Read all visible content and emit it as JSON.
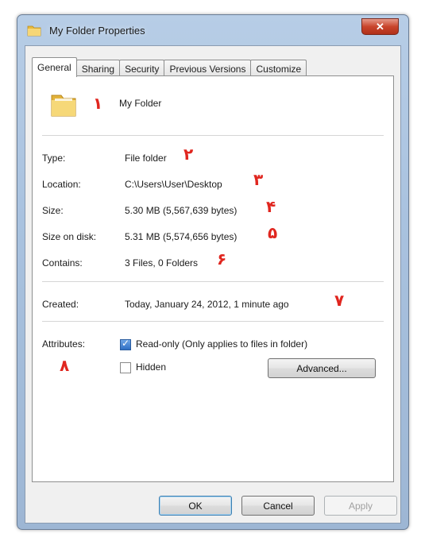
{
  "window": {
    "title": "My Folder Properties",
    "close_label": "✕"
  },
  "tabs": [
    {
      "label": "General",
      "active": true
    },
    {
      "label": "Sharing"
    },
    {
      "label": "Security"
    },
    {
      "label": "Previous Versions"
    },
    {
      "label": "Customize"
    }
  ],
  "general": {
    "folder_name": "My Folder",
    "type_label": "Type:",
    "type_value": "File folder",
    "location_label": "Location:",
    "location_value": "C:\\Users\\User\\Desktop",
    "size_label": "Size:",
    "size_value": "5.30 MB (5,567,639 bytes)",
    "size_on_disk_label": "Size on disk:",
    "size_on_disk_value": "5.31 MB (5,574,656 bytes)",
    "contains_label": "Contains:",
    "contains_value": "3 Files, 0 Folders",
    "created_label": "Created:",
    "created_value": "Today, January 24, 2012, 1 minute ago",
    "attributes_label": "Attributes:",
    "readonly_label": "Read-only (Only applies to files in folder)",
    "readonly_checked": true,
    "hidden_label": "Hidden",
    "hidden_checked": false,
    "advanced_label": "Advanced..."
  },
  "annotations": {
    "a1": "۱",
    "a2": "۲",
    "a3": "۳",
    "a4": "۴",
    "a5": "۵",
    "a6": "۶",
    "a7": "۷",
    "a8": "۸"
  },
  "footer": {
    "ok_label": "OK",
    "cancel_label": "Cancel",
    "apply_label": "Apply"
  },
  "colors": {
    "annotation": "#e0261f",
    "folder": "#f2c94c"
  }
}
